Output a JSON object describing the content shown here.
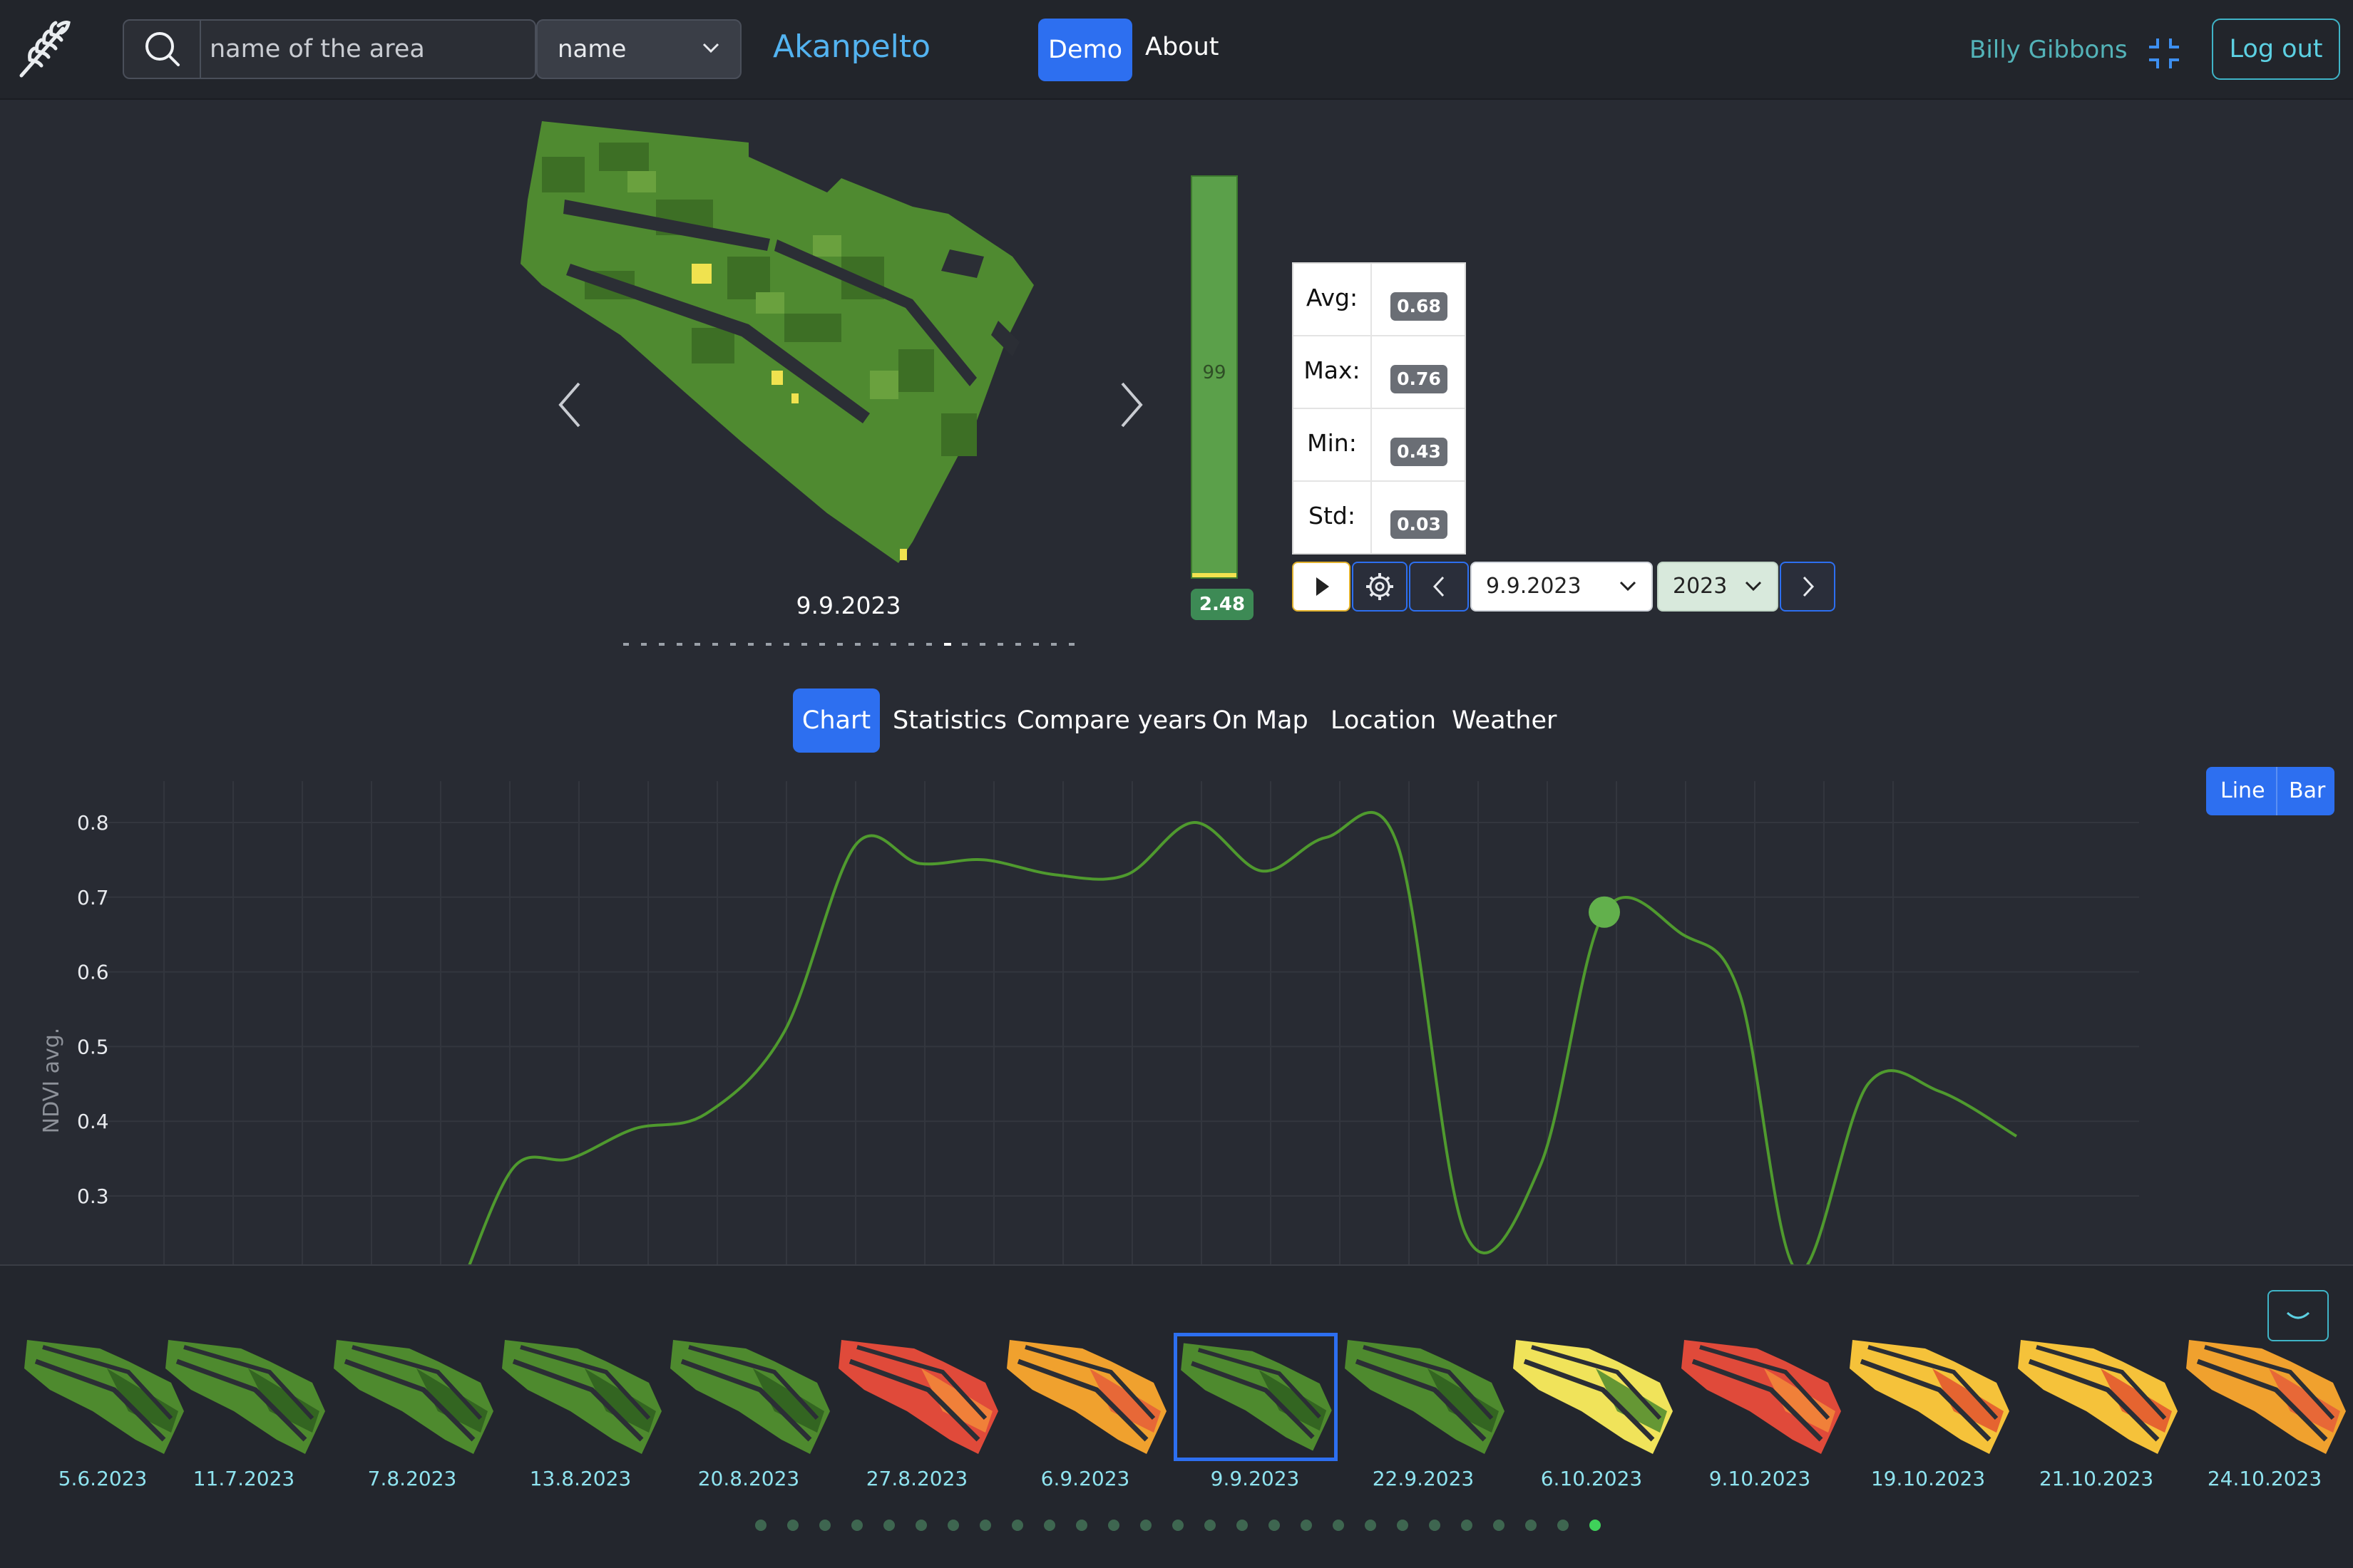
{
  "header": {
    "search_placeholder": "name of the area",
    "select_value": "name",
    "brand": "Akanpelto",
    "demo_label": "Demo",
    "about_label": "About",
    "user_name": "Billy Gibbons",
    "logout_label": "Log out"
  },
  "viewer": {
    "date": "9.9.2023",
    "legend_percent": "99",
    "legend_value": "2.48",
    "slide_count": 26,
    "active_slide": 18
  },
  "stats": [
    {
      "label": "Avg:",
      "value": "0.68"
    },
    {
      "label": "Max:",
      "value": "0.76"
    },
    {
      "label": "Min:",
      "value": "0.43"
    },
    {
      "label": "Std:",
      "value": "0.03"
    }
  ],
  "controls": {
    "date_value": "9.9.2023",
    "year_value": "2023"
  },
  "tabs": [
    "Chart",
    "Statistics",
    "Compare years",
    "On Map",
    "Location",
    "Weather"
  ],
  "active_tab": "Chart",
  "chart_toggle": {
    "line": "Line",
    "bar": "Bar"
  },
  "chart_data": {
    "type": "line",
    "ylabel": "NDVI avg.",
    "yticks": [
      "0.8",
      "0.7",
      "0.6",
      "0.5",
      "0.4",
      "0.3"
    ],
    "ylim": [
      0.2,
      0.85
    ],
    "grid": true,
    "series": [
      {
        "color": "#4f9a2e",
        "points": [
          [
            0,
            0.2
          ],
          [
            1,
            0.34
          ],
          [
            2,
            0.35
          ],
          [
            3,
            0.39
          ],
          [
            4,
            0.41
          ],
          [
            5,
            0.52
          ],
          [
            6,
            0.77
          ],
          [
            7,
            0.745
          ],
          [
            8,
            0.75
          ],
          [
            9,
            0.73
          ],
          [
            10,
            0.73
          ],
          [
            11,
            0.8
          ],
          [
            12,
            0.735
          ],
          [
            13,
            0.78
          ],
          [
            14,
            0.77
          ],
          [
            15,
            0.25
          ],
          [
            16,
            0.34
          ],
          [
            17,
            0.68
          ],
          [
            18,
            0.65
          ],
          [
            19,
            0.57
          ],
          [
            20,
            0.2
          ],
          [
            21,
            0.45
          ],
          [
            22,
            0.44
          ],
          [
            23,
            0.38
          ]
        ],
        "highlight_index": 17
      }
    ]
  },
  "thumbnails": [
    {
      "label": "5.6.2023",
      "theme": "green"
    },
    {
      "label": "11.7.2023",
      "theme": "green"
    },
    {
      "label": "7.8.2023",
      "theme": "green"
    },
    {
      "label": "13.8.2023",
      "theme": "green"
    },
    {
      "label": "20.8.2023",
      "theme": "green"
    },
    {
      "label": "27.8.2023",
      "theme": "red"
    },
    {
      "label": "6.9.2023",
      "theme": "orange"
    },
    {
      "label": "9.9.2023",
      "theme": "green",
      "selected": true
    },
    {
      "label": "22.9.2023",
      "theme": "green"
    },
    {
      "label": "6.10.2023",
      "theme": "yellow"
    },
    {
      "label": "9.10.2023",
      "theme": "red"
    },
    {
      "label": "19.10.2023",
      "theme": "yellowred"
    },
    {
      "label": "21.10.2023",
      "theme": "yellowred"
    },
    {
      "label": "24.10.2023",
      "theme": "orange"
    }
  ],
  "thumb_colors": {
    "green": [
      "#4e8a2e",
      "#2f5e1e"
    ],
    "red": [
      "#e04a3a",
      "#f28a3a"
    ],
    "orange": [
      "#f0a12e",
      "#e55e38"
    ],
    "yellow": [
      "#f0e35a",
      "#4c8a2e"
    ],
    "yellowred": [
      "#f5c23a",
      "#e2532f"
    ]
  },
  "pager": {
    "count": 27,
    "active": 26
  }
}
